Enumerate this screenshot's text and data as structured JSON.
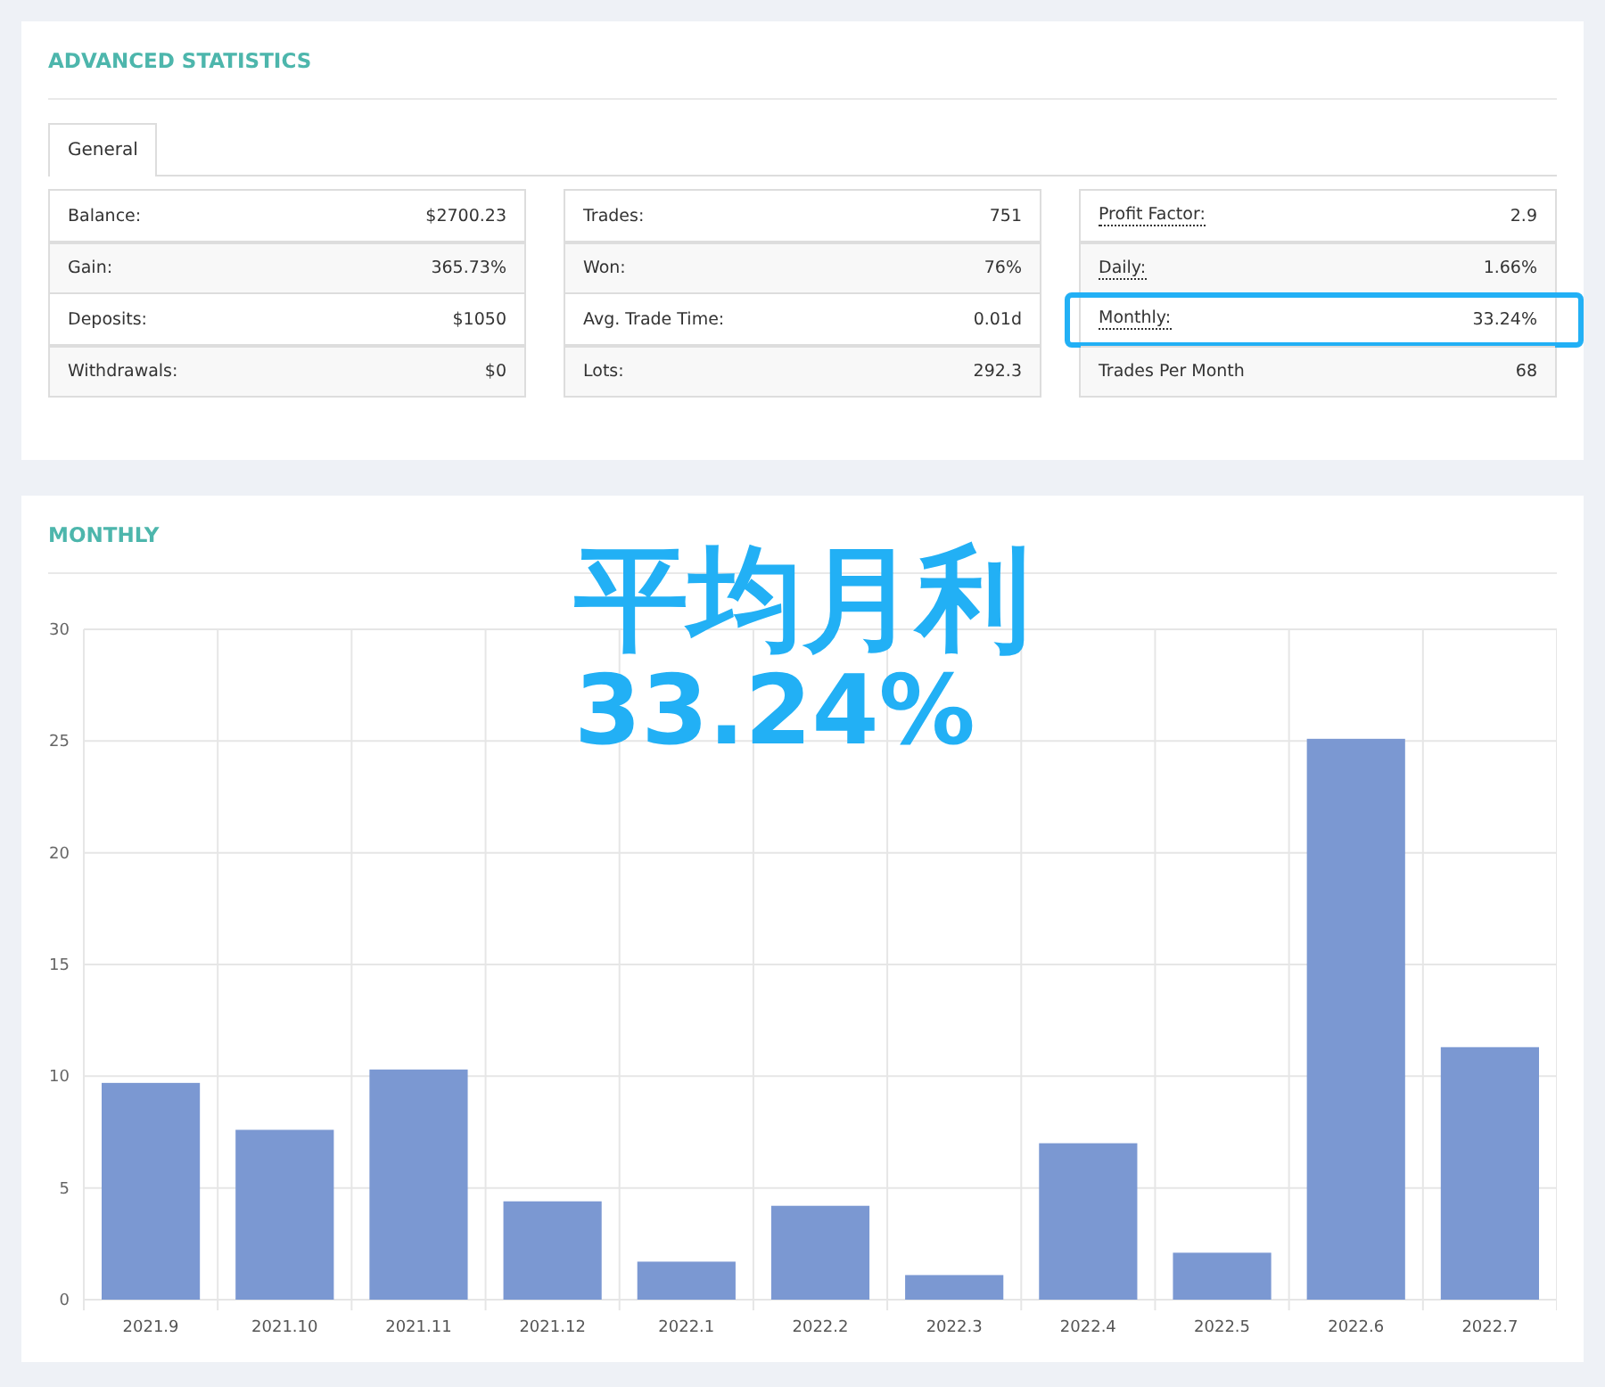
{
  "stats": {
    "title": "ADVANCED STATISTICS",
    "tabs": [
      {
        "label": "General",
        "selected": true
      }
    ],
    "tables": [
      {
        "rows": [
          {
            "label": "Balance:",
            "value": "$2700.23",
            "dotted": false,
            "highlighted": false
          },
          {
            "label": "Gain:",
            "value": "365.73%",
            "dotted": false,
            "highlighted": false
          },
          {
            "label": "Deposits:",
            "value": "$1050",
            "dotted": false,
            "highlighted": false
          },
          {
            "label": "Withdrawals:",
            "value": "$0",
            "dotted": false,
            "highlighted": false
          }
        ]
      },
      {
        "rows": [
          {
            "label": "Trades:",
            "value": "751",
            "dotted": false,
            "highlighted": false
          },
          {
            "label": "Won:",
            "value": "76%",
            "dotted": false,
            "highlighted": false
          },
          {
            "label": "Avg. Trade Time:",
            "value": "0.01d",
            "dotted": false,
            "highlighted": false
          },
          {
            "label": "Lots:",
            "value": "292.3",
            "dotted": false,
            "highlighted": false
          }
        ]
      },
      {
        "rows": [
          {
            "label": "Profit Factor:",
            "value": "2.9",
            "dotted": true,
            "highlighted": false
          },
          {
            "label": "Daily:",
            "value": "1.66%",
            "dotted": true,
            "highlighted": false
          },
          {
            "label": "Monthly:",
            "value": "33.24%",
            "dotted": true,
            "highlighted": true
          },
          {
            "label": "Trades Per Month",
            "value": "68",
            "dotted": false,
            "highlighted": false
          }
        ]
      }
    ]
  },
  "monthly": {
    "title": "MONTHLY",
    "annotation": {
      "title": "平均月利",
      "value": "33.24%"
    },
    "chart_data": {
      "type": "bar",
      "categories": [
        "2021.9",
        "2021.10",
        "2021.11",
        "2021.12",
        "2022.1",
        "2022.2",
        "2022.3",
        "2022.4",
        "2022.5",
        "2022.6",
        "2022.7"
      ],
      "grid": true,
      "series": [
        {
          "color": "#7b98d2",
          "values": [
            9.7,
            7.6,
            10.3,
            4.4,
            1.7,
            4.2,
            1.1,
            7.0,
            2.1,
            25.1,
            11.3
          ]
        }
      ],
      "ylim": [
        0,
        30
      ],
      "yticks": [
        0,
        5,
        10,
        15,
        20,
        25,
        30
      ]
    }
  }
}
